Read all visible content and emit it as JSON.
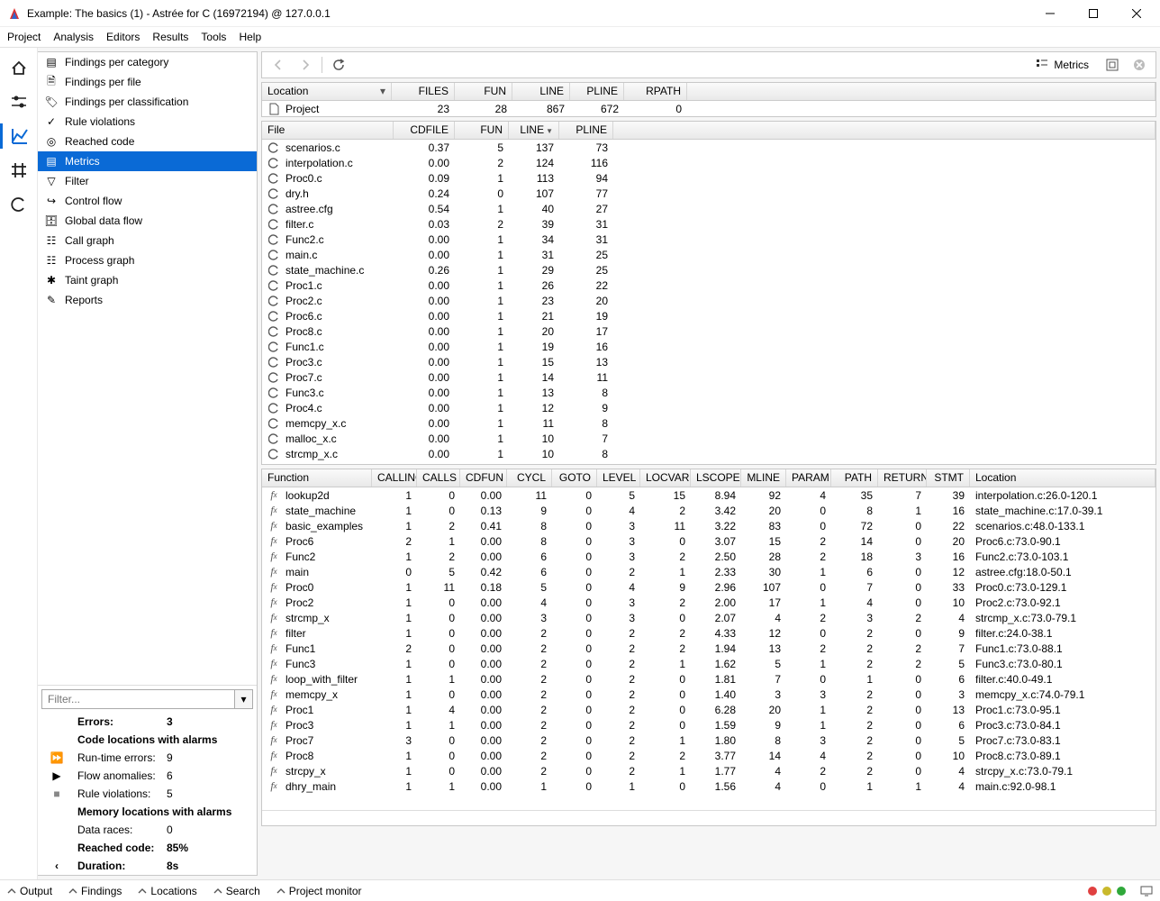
{
  "window": {
    "title": "Example: The basics (1) - Astrée for C (16972194) @ 127.0.0.1"
  },
  "menu": [
    "Project",
    "Analysis",
    "Editors",
    "Results",
    "Tools",
    "Help"
  ],
  "nav": [
    {
      "label": "Findings per category"
    },
    {
      "label": "Findings per file"
    },
    {
      "label": "Findings per classification"
    },
    {
      "label": "Rule violations"
    },
    {
      "label": "Reached code"
    },
    {
      "label": "Metrics",
      "selected": true
    },
    {
      "label": "Filter"
    },
    {
      "label": "Control flow"
    },
    {
      "label": "Global data flow"
    },
    {
      "label": "Call graph"
    },
    {
      "label": "Process graph"
    },
    {
      "label": "Taint graph"
    },
    {
      "label": "Reports"
    }
  ],
  "filter_placeholder": "Filter...",
  "summary": {
    "errors": {
      "lbl": "Errors:",
      "val": "3"
    },
    "alarms_hdr": "Code locations with alarms",
    "rte": {
      "lbl": "Run-time errors:",
      "val": "9"
    },
    "flow": {
      "lbl": "Flow anomalies:",
      "val": "6"
    },
    "rule": {
      "lbl": "Rule violations:",
      "val": "5"
    },
    "mem_hdr": "Memory locations with alarms",
    "datar": {
      "lbl": "Data races:",
      "val": "0"
    },
    "reached": {
      "lbl": "Reached code:",
      "val": "85%"
    },
    "dur": {
      "lbl": "Duration:",
      "val": "8s"
    }
  },
  "toolbar": {
    "metrics": "Metrics"
  },
  "loc": {
    "headers": [
      "Location",
      "FILES",
      "FUN",
      "LINE",
      "PLINE",
      "RPATH"
    ],
    "row": {
      "name": "Project",
      "files": "23",
      "fun": "28",
      "line": "867",
      "pline": "672",
      "rpath": "0"
    }
  },
  "file": {
    "headers": [
      "File",
      "CDFILE",
      "FUN",
      "LINE",
      "PLINE"
    ],
    "rows": [
      {
        "n": "scenarios.c",
        "cd": "0.37",
        "f": "5",
        "l": "137",
        "p": "73"
      },
      {
        "n": "interpolation.c",
        "cd": "0.00",
        "f": "2",
        "l": "124",
        "p": "116"
      },
      {
        "n": "Proc0.c",
        "cd": "0.09",
        "f": "1",
        "l": "113",
        "p": "94"
      },
      {
        "n": "dry.h",
        "cd": "0.24",
        "f": "0",
        "l": "107",
        "p": "77"
      },
      {
        "n": "astree.cfg",
        "cd": "0.54",
        "f": "1",
        "l": "40",
        "p": "27"
      },
      {
        "n": "filter.c",
        "cd": "0.03",
        "f": "2",
        "l": "39",
        "p": "31"
      },
      {
        "n": "Func2.c",
        "cd": "0.00",
        "f": "1",
        "l": "34",
        "p": "31"
      },
      {
        "n": "main.c",
        "cd": "0.00",
        "f": "1",
        "l": "31",
        "p": "25"
      },
      {
        "n": "state_machine.c",
        "cd": "0.26",
        "f": "1",
        "l": "29",
        "p": "25"
      },
      {
        "n": "Proc1.c",
        "cd": "0.00",
        "f": "1",
        "l": "26",
        "p": "22"
      },
      {
        "n": "Proc2.c",
        "cd": "0.00",
        "f": "1",
        "l": "23",
        "p": "20"
      },
      {
        "n": "Proc6.c",
        "cd": "0.00",
        "f": "1",
        "l": "21",
        "p": "19"
      },
      {
        "n": "Proc8.c",
        "cd": "0.00",
        "f": "1",
        "l": "20",
        "p": "17"
      },
      {
        "n": "Func1.c",
        "cd": "0.00",
        "f": "1",
        "l": "19",
        "p": "16"
      },
      {
        "n": "Proc3.c",
        "cd": "0.00",
        "f": "1",
        "l": "15",
        "p": "13"
      },
      {
        "n": "Proc7.c",
        "cd": "0.00",
        "f": "1",
        "l": "14",
        "p": "11"
      },
      {
        "n": "Func3.c",
        "cd": "0.00",
        "f": "1",
        "l": "13",
        "p": "8"
      },
      {
        "n": "Proc4.c",
        "cd": "0.00",
        "f": "1",
        "l": "12",
        "p": "9"
      },
      {
        "n": "memcpy_x.c",
        "cd": "0.00",
        "f": "1",
        "l": "11",
        "p": "8"
      },
      {
        "n": "malloc_x.c",
        "cd": "0.00",
        "f": "1",
        "l": "10",
        "p": "7"
      },
      {
        "n": "strcmp_x.c",
        "cd": "0.00",
        "f": "1",
        "l": "10",
        "p": "8"
      }
    ]
  },
  "func": {
    "headers": [
      "Function",
      "CALLING",
      "CALLS",
      "CDFUN",
      "CYCL",
      "GOTO",
      "LEVEL",
      "LOCVAR",
      "LSCOPE",
      "MLINE",
      "PARAM",
      "PATH",
      "RETURN",
      "STMT",
      "Location"
    ],
    "rows": [
      {
        "n": "lookup2d",
        "c": [
          "1",
          "0",
          "0.00",
          "11",
          "0",
          "5",
          "15",
          "8.94",
          "92",
          "4",
          "35",
          "7",
          "39"
        ],
        "loc": "interpolation.c:26.0-120.1"
      },
      {
        "n": "state_machine",
        "c": [
          "1",
          "0",
          "0.13",
          "9",
          "0",
          "4",
          "2",
          "3.42",
          "20",
          "0",
          "8",
          "1",
          "16"
        ],
        "loc": "state_machine.c:17.0-39.1"
      },
      {
        "n": "basic_examples",
        "c": [
          "1",
          "2",
          "0.41",
          "8",
          "0",
          "3",
          "11",
          "3.22",
          "83",
          "0",
          "72",
          "0",
          "22"
        ],
        "loc": "scenarios.c:48.0-133.1"
      },
      {
        "n": "Proc6",
        "c": [
          "2",
          "1",
          "0.00",
          "8",
          "0",
          "3",
          "0",
          "3.07",
          "15",
          "2",
          "14",
          "0",
          "20"
        ],
        "loc": "Proc6.c:73.0-90.1"
      },
      {
        "n": "Func2",
        "c": [
          "1",
          "2",
          "0.00",
          "6",
          "0",
          "3",
          "2",
          "2.50",
          "28",
          "2",
          "18",
          "3",
          "16"
        ],
        "loc": "Func2.c:73.0-103.1"
      },
      {
        "n": "main",
        "c": [
          "0",
          "5",
          "0.42",
          "6",
          "0",
          "2",
          "1",
          "2.33",
          "30",
          "1",
          "6",
          "0",
          "12"
        ],
        "loc": "astree.cfg:18.0-50.1"
      },
      {
        "n": "Proc0",
        "c": [
          "1",
          "11",
          "0.18",
          "5",
          "0",
          "4",
          "9",
          "2.96",
          "107",
          "0",
          "7",
          "0",
          "33"
        ],
        "loc": "Proc0.c:73.0-129.1"
      },
      {
        "n": "Proc2",
        "c": [
          "1",
          "0",
          "0.00",
          "4",
          "0",
          "3",
          "2",
          "2.00",
          "17",
          "1",
          "4",
          "0",
          "10"
        ],
        "loc": "Proc2.c:73.0-92.1"
      },
      {
        "n": "strcmp_x",
        "c": [
          "1",
          "0",
          "0.00",
          "3",
          "0",
          "3",
          "0",
          "2.07",
          "4",
          "2",
          "3",
          "2",
          "4"
        ],
        "loc": "strcmp_x.c:73.0-79.1"
      },
      {
        "n": "filter",
        "c": [
          "1",
          "0",
          "0.00",
          "2",
          "0",
          "2",
          "2",
          "4.33",
          "12",
          "0",
          "2",
          "0",
          "9"
        ],
        "loc": "filter.c:24.0-38.1"
      },
      {
        "n": "Func1",
        "c": [
          "2",
          "0",
          "0.00",
          "2",
          "0",
          "2",
          "2",
          "1.94",
          "13",
          "2",
          "2",
          "2",
          "7"
        ],
        "loc": "Func1.c:73.0-88.1"
      },
      {
        "n": "Func3",
        "c": [
          "1",
          "0",
          "0.00",
          "2",
          "0",
          "2",
          "1",
          "1.62",
          "5",
          "1",
          "2",
          "2",
          "5"
        ],
        "loc": "Func3.c:73.0-80.1"
      },
      {
        "n": "loop_with_filter",
        "c": [
          "1",
          "1",
          "0.00",
          "2",
          "0",
          "2",
          "0",
          "1.81",
          "7",
          "0",
          "1",
          "0",
          "6"
        ],
        "loc": "filter.c:40.0-49.1"
      },
      {
        "n": "memcpy_x",
        "c": [
          "1",
          "0",
          "0.00",
          "2",
          "0",
          "2",
          "0",
          "1.40",
          "3",
          "3",
          "2",
          "0",
          "3"
        ],
        "loc": "memcpy_x.c:74.0-79.1"
      },
      {
        "n": "Proc1",
        "c": [
          "1",
          "4",
          "0.00",
          "2",
          "0",
          "2",
          "0",
          "6.28",
          "20",
          "1",
          "2",
          "0",
          "13"
        ],
        "loc": "Proc1.c:73.0-95.1"
      },
      {
        "n": "Proc3",
        "c": [
          "1",
          "1",
          "0.00",
          "2",
          "0",
          "2",
          "0",
          "1.59",
          "9",
          "1",
          "2",
          "0",
          "6"
        ],
        "loc": "Proc3.c:73.0-84.1"
      },
      {
        "n": "Proc7",
        "c": [
          "3",
          "0",
          "0.00",
          "2",
          "0",
          "2",
          "1",
          "1.80",
          "8",
          "3",
          "2",
          "0",
          "5"
        ],
        "loc": "Proc7.c:73.0-83.1"
      },
      {
        "n": "Proc8",
        "c": [
          "1",
          "0",
          "0.00",
          "2",
          "0",
          "2",
          "2",
          "3.77",
          "14",
          "4",
          "2",
          "0",
          "10"
        ],
        "loc": "Proc8.c:73.0-89.1"
      },
      {
        "n": "strcpy_x",
        "c": [
          "1",
          "0",
          "0.00",
          "2",
          "0",
          "2",
          "1",
          "1.77",
          "4",
          "2",
          "2",
          "0",
          "4"
        ],
        "loc": "strcpy_x.c:73.0-79.1"
      },
      {
        "n": "dhry_main",
        "c": [
          "1",
          "1",
          "0.00",
          "1",
          "0",
          "1",
          "0",
          "1.56",
          "4",
          "0",
          "1",
          "1",
          "4"
        ],
        "loc": "main.c:92.0-98.1"
      }
    ]
  },
  "status_tabs": [
    "Output",
    "Findings",
    "Locations",
    "Search",
    "Project monitor"
  ]
}
